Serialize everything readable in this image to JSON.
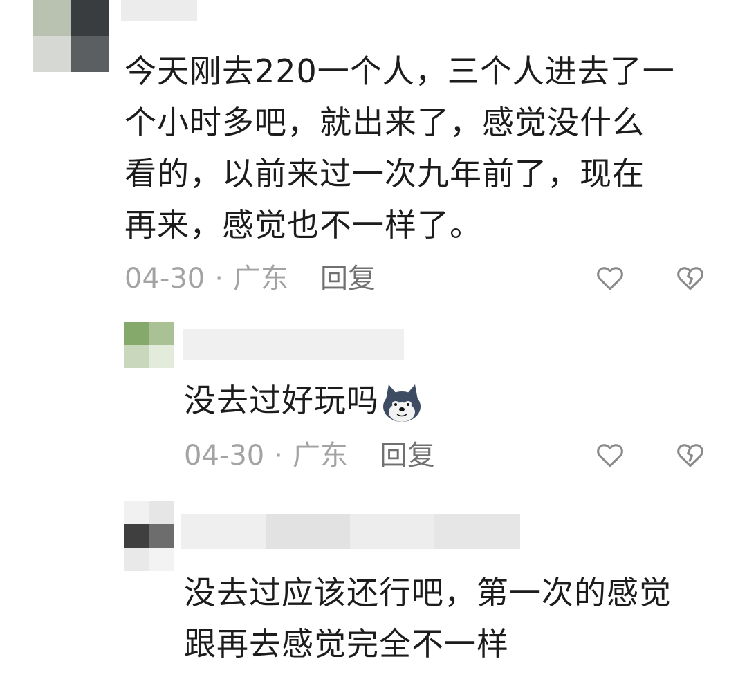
{
  "comments": [
    {
      "text": "今天刚去220一个人，三个人进去了一\n个小时多吧，就出来了，感觉没什么\n看的，以前来过一次九年前了，现在\n再来，感觉也不一样了。",
      "date": "04-30",
      "separator": "·",
      "location": "广东",
      "reply_label": "回复",
      "like_icon": "heart-outline-icon",
      "dislike_icon": "broken-heart-icon"
    },
    {
      "text": "没去过好玩吗",
      "emoji": "husky-dog-emoji",
      "date": "04-30",
      "separator": "·",
      "location": "广东",
      "reply_label": "回复",
      "like_icon": "heart-outline-icon",
      "dislike_icon": "broken-heart-icon"
    },
    {
      "text": "没去过应该还行吧，第一次的感觉\n跟再去感觉完全不一样"
    }
  ],
  "colors": {
    "text": "#1c1c1c",
    "meta": "#a3a3a3",
    "reply": "#707070",
    "icon": "#8a8a8a"
  }
}
